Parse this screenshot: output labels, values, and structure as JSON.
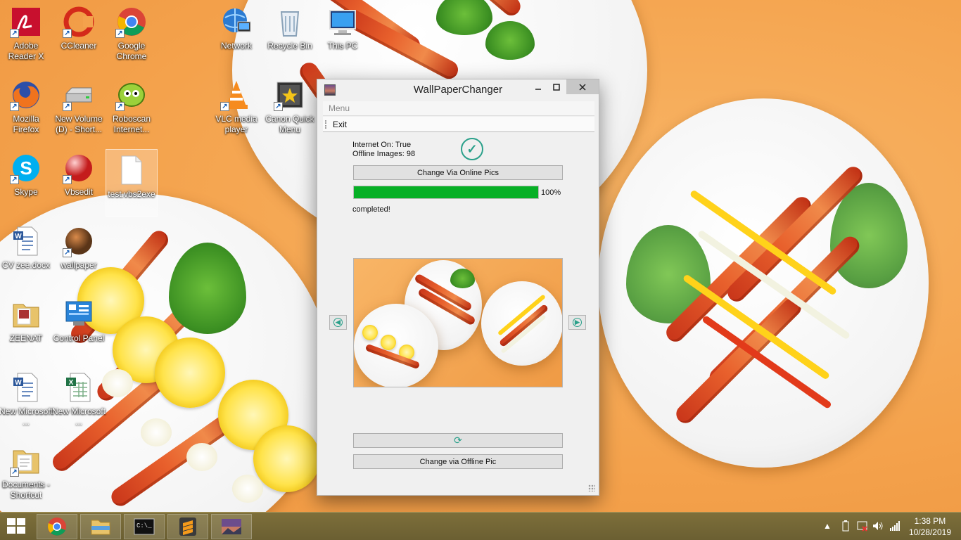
{
  "desktop": {
    "icons": [
      {
        "label": "Adobe Reader X",
        "icon": "adobe-reader-icon"
      },
      {
        "label": "CCleaner",
        "icon": "ccleaner-icon"
      },
      {
        "label": "Google Chrome",
        "icon": "chrome-icon"
      },
      {
        "label": "Network",
        "icon": "network-icon"
      },
      {
        "label": "Recycle Bin",
        "icon": "recycle-bin-icon"
      },
      {
        "label": "This PC",
        "icon": "computer-icon"
      },
      {
        "label": "Mozilla Firefox",
        "icon": "firefox-icon"
      },
      {
        "label": "New Volume (D) - Short...",
        "icon": "drive-icon"
      },
      {
        "label": "Roboscan Internet...",
        "icon": "roboscan-icon"
      },
      {
        "label": "VLC media player",
        "icon": "vlc-icon"
      },
      {
        "label": "Canon Quick Menu",
        "icon": "canon-icon"
      },
      {
        "label": "Skype",
        "icon": "skype-icon"
      },
      {
        "label": "Vbsedit",
        "icon": "vbsedit-icon"
      },
      {
        "label": "test.vbs2exe",
        "icon": "file-icon"
      },
      {
        "label": "CV zee.docx",
        "icon": "word-doc-icon"
      },
      {
        "label": "wallpaper",
        "icon": "image-icon"
      },
      {
        "label": "ZEENAT",
        "icon": "folder-icon"
      },
      {
        "label": "Control Panel",
        "icon": "control-panel-icon"
      },
      {
        "label": "New Microsoft ...",
        "icon": "word-doc-icon"
      },
      {
        "label": "New Microsoft ...",
        "icon": "excel-doc-icon"
      },
      {
        "label": "Documents - Shortcut",
        "icon": "folder-icon"
      }
    ]
  },
  "window": {
    "title": "WallPaperChanger",
    "menu_label": "Menu",
    "exit_label": "Exit",
    "internet_status": "Internet On: True",
    "offline_images": "Offline Images: 98",
    "online_button": "Change Via Online Pics",
    "progress_percent": "100%",
    "progress_value": 100,
    "status_text": "completed!",
    "offline_button": "Change via Offline Pic",
    "refresh_icon": "refresh-icon",
    "prev_icon": "arrow-left-icon",
    "next_icon": "arrow-right-icon"
  },
  "taskbar": {
    "apps": [
      "chrome",
      "file-explorer",
      "command-prompt",
      "sublime-text",
      "wallpaperchanger"
    ],
    "time": "1:38 PM",
    "date": "10/28/2019"
  },
  "colors": {
    "progress_fill": "#06b025",
    "accent": "#2aa08a",
    "taskbar": "#6b5f32",
    "wallpaper": "#f4a24c"
  }
}
